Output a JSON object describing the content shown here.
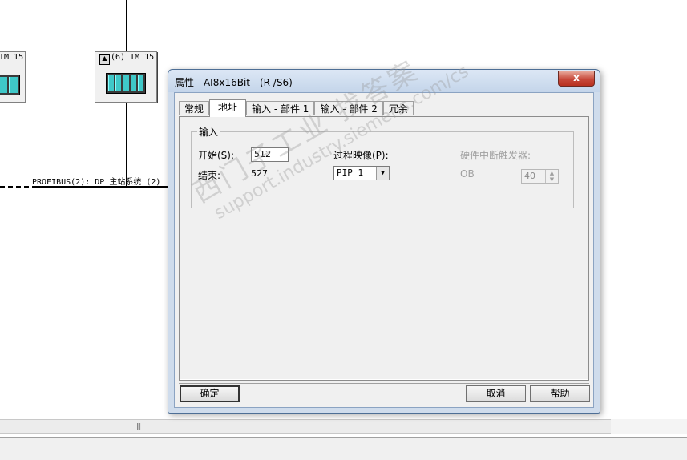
{
  "background": {
    "module_left_label": "IM 15",
    "module_right_label": "(6) IM 15",
    "profibus_label": "PROFIBUS(2): DP 主站系统 (2)"
  },
  "dialog": {
    "title": "属性 - AI8x16Bit - (R-/S6)",
    "close_symbol": "x",
    "tabs": [
      {
        "label": "常规"
      },
      {
        "label": "地址"
      },
      {
        "label": "输入 - 部件 1"
      },
      {
        "label": "输入 - 部件 2"
      },
      {
        "label": "冗余"
      }
    ],
    "active_tab": "地址",
    "group_title": "输入",
    "start_label": "开始(S):",
    "start_value": "512",
    "end_label": "结束:",
    "end_value": "527",
    "process_image_label": "过程映像(P):",
    "process_image_value": "PIP 1",
    "hw_interrupt_label": "硬件中断触发器:",
    "ob_label": "OB",
    "ob_value": "40",
    "buttons": {
      "ok": "确定",
      "cancel": "取消",
      "help": "帮助"
    }
  },
  "watermark": {
    "line1": "西门子工业  找答案",
    "line2": "support.industry.siemens.com/cs"
  },
  "colors": {
    "dialog_frame": "#cfdcec",
    "close_button": "#c7493a",
    "module_slot": "#3fc8c8"
  },
  "icons": [
    "close-icon",
    "dropdown-arrow-icon",
    "spinner-icon",
    "station-icon"
  ]
}
